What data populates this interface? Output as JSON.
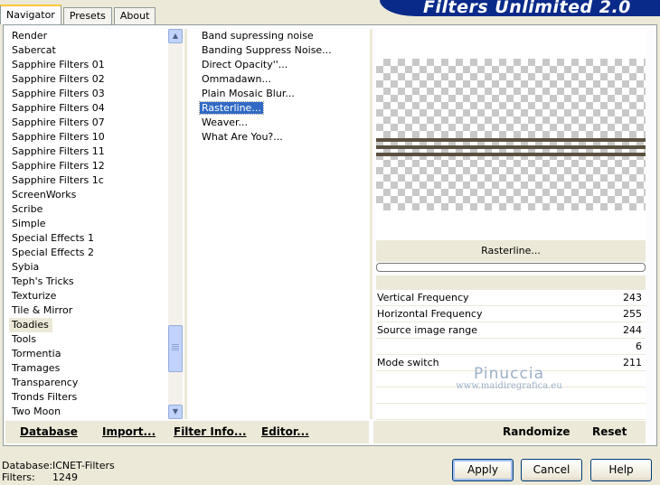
{
  "tabs": [
    {
      "label": "Navigator",
      "active": true
    },
    {
      "label": "Presets",
      "active": false
    },
    {
      "label": "About",
      "active": false
    }
  ],
  "banner_title": "Filters Unlimited 2.0",
  "categories": {
    "items": [
      "Render",
      "Sabercat",
      "Sapphire Filters 01",
      "Sapphire Filters 02",
      "Sapphire Filters 03",
      "Sapphire Filters 04",
      "Sapphire Filters 07",
      "Sapphire Filters 10",
      "Sapphire Filters 11",
      "Sapphire Filters 12",
      "Sapphire Filters 1c",
      "ScreenWorks",
      "Scribe",
      "Simple",
      "Special Effects 1",
      "Special Effects 2",
      "Sybia",
      "Teph's Tricks",
      "Texturize",
      "Tile & Mirror",
      "Toadies",
      "Tools",
      "Tormentia",
      "Tramages",
      "Transparency",
      "Tronds Filters",
      "Two Moon"
    ],
    "selected": "Toadies"
  },
  "filters": {
    "items": [
      "Band supressing noise",
      "Banding Suppress Noise...",
      "Direct Opacity''...",
      "Ommadawn...",
      "Plain Mosaic Blur...",
      "Rasterline...",
      "Weaver...",
      "What Are You?..."
    ],
    "selected": "Rasterline..."
  },
  "preview": {
    "stripe_color": "#5b5140",
    "stripe_gap_color": "#ffffff"
  },
  "filter_name": "Rasterline...",
  "params": [
    {
      "name": "Vertical Frequency",
      "value": "243"
    },
    {
      "name": "Horizontal Frequency",
      "value": "255"
    },
    {
      "name": "Source image range",
      "value": "244"
    },
    {
      "name": "",
      "value": "6"
    },
    {
      "name": "Mode switch",
      "value": "211"
    },
    {
      "name": "",
      "value": ""
    },
    {
      "name": "",
      "value": ""
    },
    {
      "name": "",
      "value": ""
    }
  ],
  "watermark": {
    "line1": "Pinuccia",
    "line2": "www.maidiregrafica.eu"
  },
  "toolbar": {
    "database": "Database",
    "import": "Import...",
    "filter_info": "Filter Info...",
    "editor": "Editor...",
    "randomize": "Randomize",
    "reset": "Reset"
  },
  "status": {
    "database_label": "Database:",
    "database_value": "ICNET-Filters",
    "filters_label": "Filters:",
    "filters_value": "1249"
  },
  "buttons": {
    "apply": "Apply",
    "cancel": "Cancel",
    "help": "Help"
  },
  "icons": {
    "scroll_up": "chevron-up-icon",
    "scroll_down": "chevron-down-icon"
  }
}
